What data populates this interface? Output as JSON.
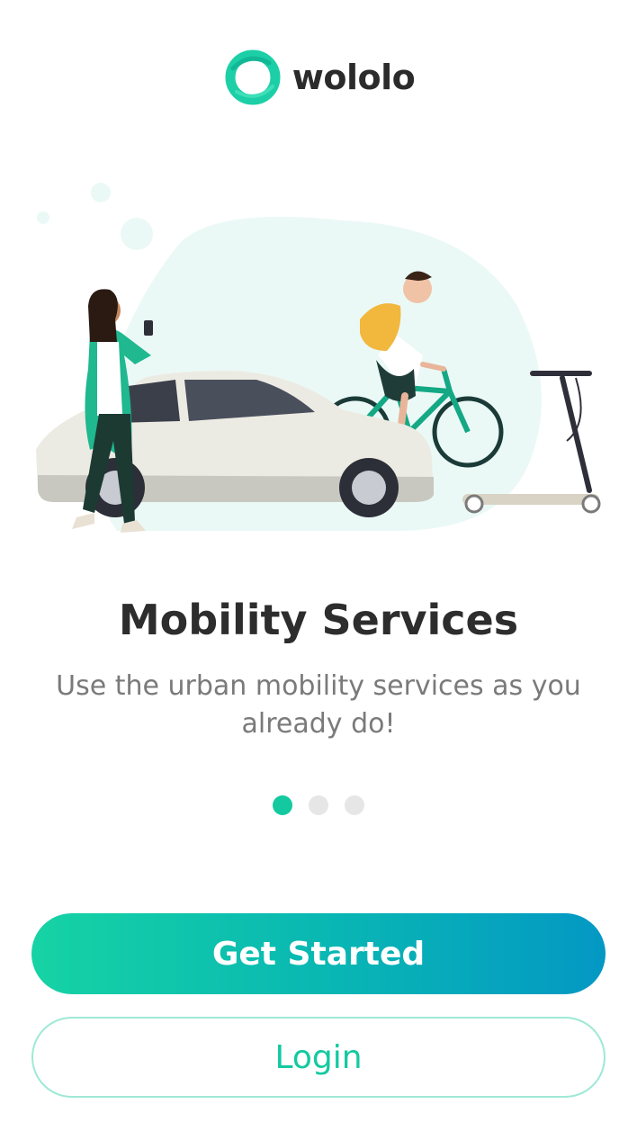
{
  "brand": {
    "name": "wololo",
    "logo_icon": "ring-logo-icon",
    "accent_color": "#14c9a0"
  },
  "hero": {
    "illustration": "urban-mobility-illustration"
  },
  "onboarding": {
    "title": "Mobility Services",
    "subtitle": "Use the urban mobility services as you already do!",
    "pager": {
      "total": 3,
      "active_index": 0
    }
  },
  "actions": {
    "primary_label": "Get Started",
    "secondary_label": "Login",
    "gradient": [
      "#16d3a4",
      "#0498c4"
    ]
  }
}
